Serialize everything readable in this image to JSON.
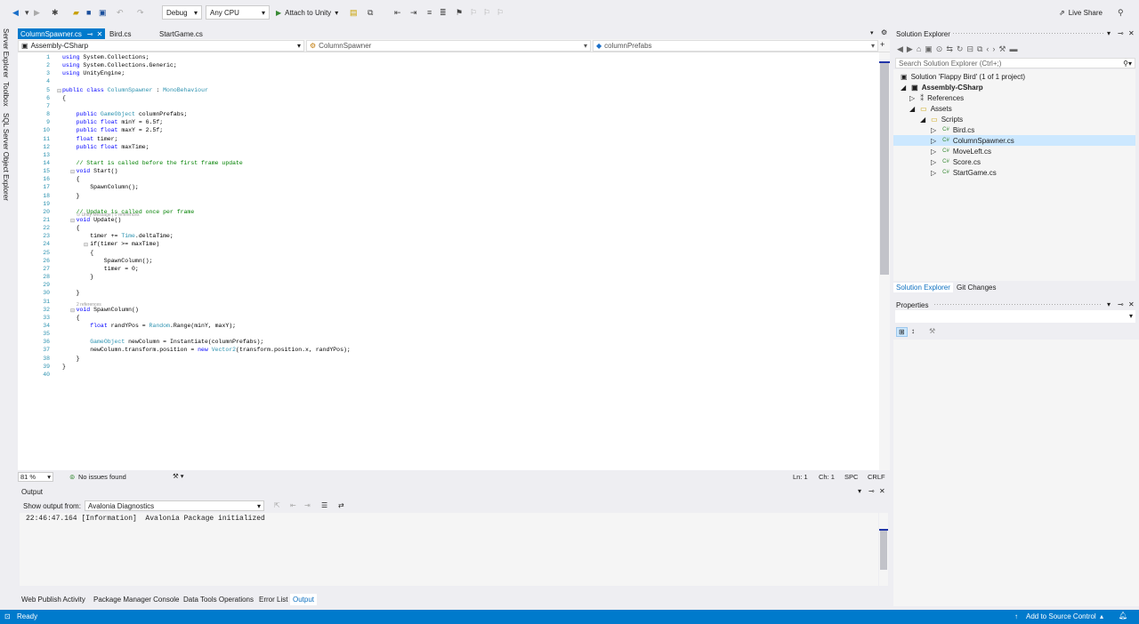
{
  "toolbar": {
    "config": "Debug",
    "platform": "Any CPU",
    "attach": "Attach to Unity",
    "live_share": "Live Share"
  },
  "left_tabs": [
    "Server Explorer",
    "Toolbox",
    "SQL Server Object Explorer"
  ],
  "doc_tabs": [
    "ColumnSpawner.cs",
    "Bird.cs",
    "StartGame.cs"
  ],
  "nav": {
    "project": "Assembly-CSharp",
    "type": "ColumnSpawner",
    "member": "columnPrefabs"
  },
  "code_lines": [
    {
      "n": "1",
      "t": "using System.Collections;"
    },
    {
      "n": "2",
      "t": "using System.Collections.Generic;"
    },
    {
      "n": "3",
      "t": "using UnityEngine;"
    },
    {
      "n": "4",
      "t": ""
    },
    {
      "n": "5",
      "t": "public class ColumnSpawner : MonoBehaviour"
    },
    {
      "n": "6",
      "t": "{"
    },
    {
      "n": "7",
      "t": ""
    },
    {
      "n": "8",
      "t": "    public GameObject columnPrefabs;"
    },
    {
      "n": "9",
      "t": "    public float minY = 6.5f;"
    },
    {
      "n": "10",
      "t": "    public float maxY = 2.5f;"
    },
    {
      "n": "11",
      "t": "    float timer;"
    },
    {
      "n": "12",
      "t": "    public float maxTime;"
    },
    {
      "n": "13",
      "t": ""
    },
    {
      "n": "14",
      "t": "    // Start is called before the first frame update"
    },
    {
      "n": "15",
      "t": "    void Start()"
    },
    {
      "n": "16",
      "t": "    {"
    },
    {
      "n": "17",
      "t": "        SpawnColumn();"
    },
    {
      "n": "18",
      "t": "    }"
    },
    {
      "n": "19",
      "t": ""
    },
    {
      "n": "20",
      "t": "    // Update is called once per frame"
    },
    {
      "n": "21",
      "t": "    void Update()"
    },
    {
      "n": "22",
      "t": "    {"
    },
    {
      "n": "23",
      "t": "        timer += Time.deltaTime;"
    },
    {
      "n": "24",
      "t": "        if(timer >= maxTime)"
    },
    {
      "n": "25",
      "t": "        {"
    },
    {
      "n": "26",
      "t": "            SpawnColumn();"
    },
    {
      "n": "27",
      "t": "            timer = 0;"
    },
    {
      "n": "28",
      "t": "        }"
    },
    {
      "n": "29",
      "t": ""
    },
    {
      "n": "30",
      "t": "    }"
    },
    {
      "n": "31",
      "t": ""
    },
    {
      "n": "32",
      "t": "    void SpawnColumn()"
    },
    {
      "n": "33",
      "t": "    {"
    },
    {
      "n": "34",
      "t": "        float randYPos = Random.Range(minY, maxY);"
    },
    {
      "n": "35",
      "t": ""
    },
    {
      "n": "36",
      "t": "        GameObject newColumn = Instantiate(columnPrefabs);"
    },
    {
      "n": "37",
      "t": "        newColumn.transform.position = new Vector2(transform.position.x, randYPos);"
    },
    {
      "n": "38",
      "t": "    }"
    },
    {
      "n": "39",
      "t": "}"
    },
    {
      "n": "40",
      "t": ""
    }
  ],
  "hints": {
    "update": "⊙ Unity Message | 0 references",
    "spawn": "2 references"
  },
  "editor_status": {
    "zoom": "81 %",
    "issues": "No issues found",
    "ln": "Ln: 1",
    "ch": "Ch: 1",
    "spc": "SPC",
    "crlf": "CRLF"
  },
  "output": {
    "title": "Output",
    "show_from_label": "Show output from:",
    "source": "Avalonia Diagnostics",
    "text": "22:46:47.164 [Information]  Avalonia Package initialized"
  },
  "bottom_tabs": [
    "Web Publish Activity",
    "Package Manager Console",
    "Data Tools Operations",
    "Error List",
    "Output"
  ],
  "status": {
    "ready": "Ready",
    "source_control": "Add to Source Control"
  },
  "solution": {
    "title": "Solution Explorer",
    "search": "Search Solution Explorer (Ctrl+;)",
    "items": [
      "Solution 'Flappy Bird' (1 of 1 project)",
      "Assembly-CSharp",
      "References",
      "Assets",
      "Scripts",
      "Bird.cs",
      "ColumnSpawner.cs",
      "MoveLeft.cs",
      "Score.cs",
      "StartGame.cs"
    ],
    "tabs": [
      "Solution Explorer",
      "Git Changes"
    ]
  },
  "properties": {
    "title": "Properties"
  },
  "colors": {
    "accent": "#007acc",
    "keyword": "#0000ff",
    "type": "#2b91af",
    "comment": "#008000"
  }
}
